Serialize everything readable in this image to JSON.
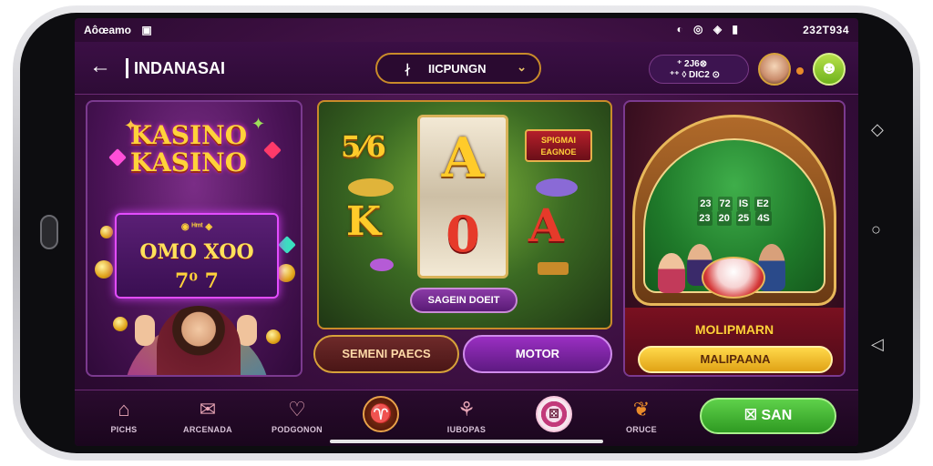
{
  "status_bar": {
    "left_text": "Aôœamo",
    "left_badge": "▣",
    "icons": "◐ ◎ ◈ ▮",
    "time": "232T934"
  },
  "header": {
    "back_icon": "←",
    "title": "INDANASAI",
    "dropdown": {
      "lead": "∤",
      "label": "IICPUNGN",
      "chevron": "⌄"
    },
    "balance": {
      "line1": "⁺ 2J6⊗",
      "line2": "⁺⁺ ◊ DIC2 ⊙"
    },
    "profile_icon": "☻"
  },
  "left_panel": {
    "logo_line1": "KASINO",
    "logo_line2": "KASINO",
    "slot_row_top": "◉ ᴴᵐᵗ ◈",
    "slot_row_main": "OMO XOO",
    "slot_row_bottom": "7⁰ 7"
  },
  "mid_panel": {
    "badge_text": "SPIGMAI\nEAGNOE",
    "sym_left_top": "5⁄6",
    "sym_left_mid": "K",
    "sym_center_top": "A",
    "sym_center_bottom": "0",
    "sym_right": "A",
    "pill_label": "SAGEIN DOEIT",
    "btn_left": "SEMENI PAECS",
    "btn_right": "MOTOR"
  },
  "right_panel": {
    "table_row1": [
      "23",
      "72",
      "IS",
      "E2"
    ],
    "table_row2": [
      "23",
      "20",
      "25",
      "4S"
    ],
    "title": "MOLIPMARN",
    "button": "MALIPAANA"
  },
  "bottom_nav": {
    "items": [
      {
        "icon": "⌂",
        "label": "PICHS"
      },
      {
        "icon": "✉",
        "label": "ARCENADA"
      },
      {
        "icon": "♡",
        "label": "PODGONON"
      },
      {
        "icon": "♈",
        "label": ""
      },
      {
        "icon": "⚘",
        "label": "IUBOPAS"
      },
      {
        "icon": "⚄",
        "label": ""
      },
      {
        "icon": "❦",
        "label": "ORUCE"
      }
    ],
    "cta": "☒ SAN"
  },
  "colors": {
    "primary": "#3a0f3f",
    "accent_gold": "#ffd23a",
    "accent_green": "#5ed14a",
    "accent_purple": "#9a2fc2"
  }
}
